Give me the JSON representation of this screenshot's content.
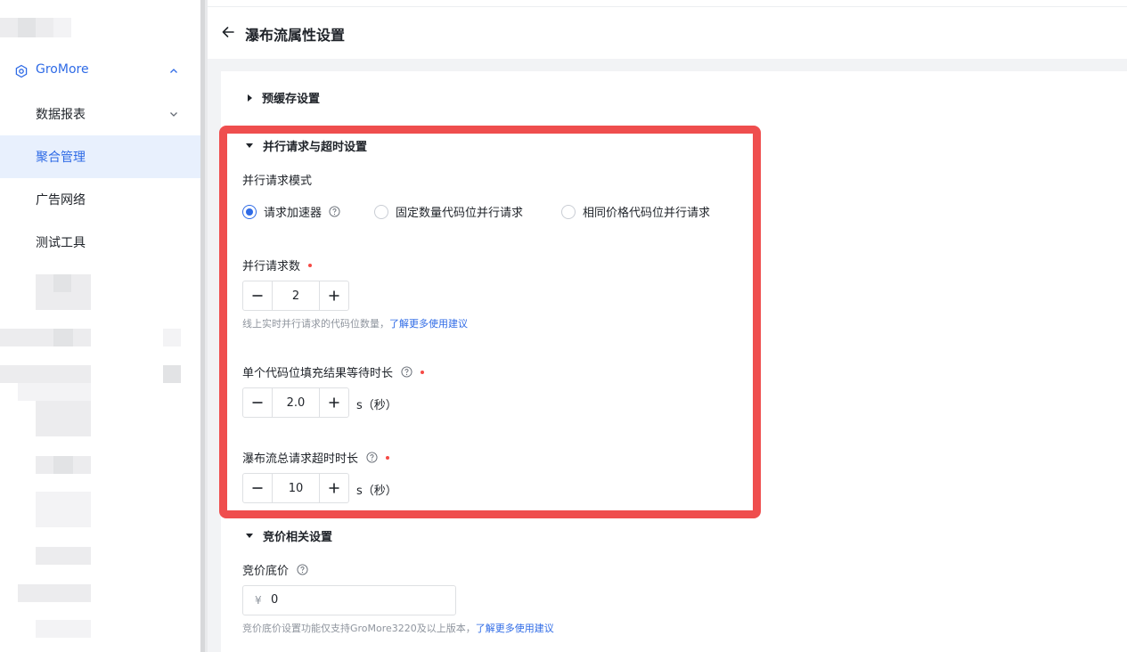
{
  "sidebar": {
    "group": {
      "label": "GroMore"
    },
    "items": [
      {
        "label": "数据报表",
        "has_chevron": true
      },
      {
        "label": "聚合管理",
        "active": true
      },
      {
        "label": "广告网络"
      },
      {
        "label": "测试工具"
      }
    ]
  },
  "header": {
    "title": "瀑布流属性设置"
  },
  "sections": {
    "precache": {
      "title": "预缓存设置"
    },
    "parallel": {
      "title": "并行请求与超时设置",
      "mode_label": "并行请求模式",
      "modes": [
        {
          "label": "请求加速器",
          "checked": true
        },
        {
          "label": "固定数量代码位并行请求",
          "checked": false
        },
        {
          "label": "相同价格代码位并行请求",
          "checked": false
        }
      ],
      "count_label": "并行请求数",
      "count_value": "2",
      "count_hint": "线上实时并行请求的代码位数量，",
      "count_hint_link": "了解更多使用建议",
      "wait_label": "单个代码位填充结果等待时长",
      "wait_value": "2.0",
      "wait_unit": "s（秒）",
      "timeout_label": "瀑布流总请求超时时长",
      "timeout_value": "10",
      "timeout_unit": "s（秒）"
    },
    "bidding": {
      "title": "竞价相关设置",
      "floor_label": "竞价底价",
      "currency_symbol": "¥",
      "floor_value": "0",
      "floor_hint": "竞价底价设置功能仅支持GroMore3220及以上版本，",
      "floor_hint_link": "了解更多使用建议"
    }
  },
  "colors": {
    "accent": "#2f6be6",
    "highlight": "#ef4e4e",
    "required": "#f54a45"
  }
}
